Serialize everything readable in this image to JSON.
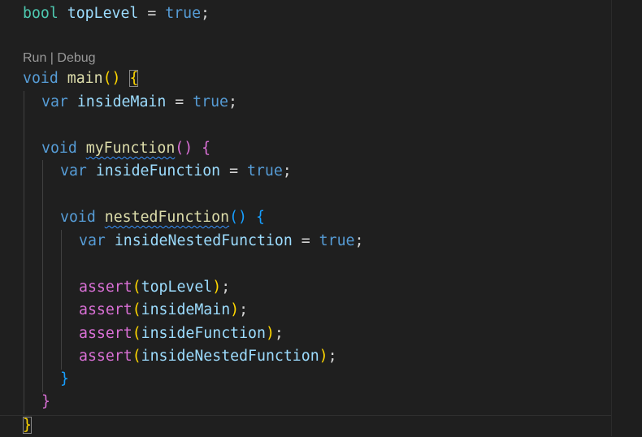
{
  "editor": {
    "codelens": {
      "run": "Run",
      "separator": " | ",
      "debug": "Debug"
    },
    "lines": {
      "l1": {
        "t1": "bool",
        "t2": "topLevel",
        "t3": "=",
        "t4": "true",
        "t5": ";"
      },
      "l4": {
        "t1": "void",
        "t2": "main",
        "t3": "(",
        "t4": ")",
        "t5": "{"
      },
      "l5": {
        "t1": "var",
        "t2": "insideMain",
        "t3": "=",
        "t4": "true",
        "t5": ";"
      },
      "l7": {
        "t1": "void",
        "t2": "myFunction",
        "t3": "(",
        "t4": ")",
        "t5": "{"
      },
      "l8": {
        "t1": "var",
        "t2": "insideFunction",
        "t3": "=",
        "t4": "true",
        "t5": ";"
      },
      "l10": {
        "t1": "void",
        "t2": "nestedFunction",
        "t3": "(",
        "t4": ")",
        "t5": "{"
      },
      "l11": {
        "t1": "var",
        "t2": "insideNestedFunction",
        "t3": "=",
        "t4": "true",
        "t5": ";"
      },
      "l13": {
        "t1": "assert",
        "t2": "(",
        "t3": "topLevel",
        "t4": ")",
        "t5": ";"
      },
      "l14": {
        "t1": "assert",
        "t2": "(",
        "t3": "insideMain",
        "t4": ")",
        "t5": ";"
      },
      "l15": {
        "t1": "assert",
        "t2": "(",
        "t3": "insideFunction",
        "t4": ")",
        "t5": ";"
      },
      "l16": {
        "t1": "assert",
        "t2": "(",
        "t3": "insideNestedFunction",
        "t4": ")",
        "t5": ";"
      },
      "l17": {
        "t1": "}"
      },
      "l18": {
        "t1": "}"
      },
      "l19": {
        "t1": "}"
      }
    }
  }
}
